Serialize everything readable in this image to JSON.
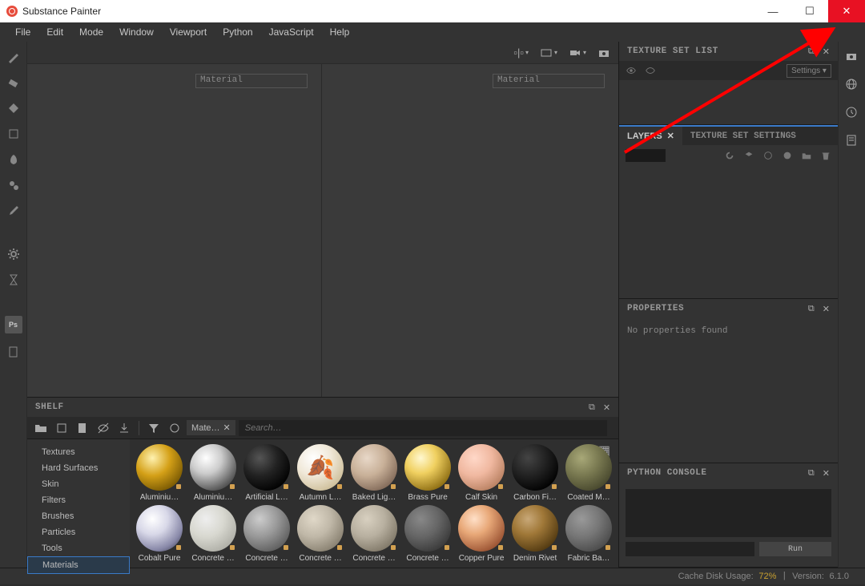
{
  "window": {
    "title": "Substance Painter"
  },
  "menu": [
    "File",
    "Edit",
    "Mode",
    "Window",
    "Viewport",
    "Python",
    "JavaScript",
    "Help"
  ],
  "viewport": {
    "material_label": "Material"
  },
  "shelf": {
    "title": "SHELF",
    "filter_tag": "Mate…",
    "search_placeholder": "Search…",
    "categories": [
      "Textures",
      "Hard Surfaces",
      "Skin",
      "Filters",
      "Brushes",
      "Particles",
      "Tools",
      "Materials"
    ],
    "active_category": "Materials",
    "materials_row1": [
      "Aluminiu…",
      "Aluminiu…",
      "Artificial L…",
      "Autumn L…",
      "Baked Lig…",
      "Brass Pure",
      "Calf Skin",
      "Carbon Fi…",
      "Coated M…"
    ],
    "materials_row2": [
      "Cobalt Pure",
      "Concrete …",
      "Concrete …",
      "Concrete …",
      "Concrete …",
      "Concrete …",
      "Copper Pure",
      "Denim Rivet",
      "Fabric Ba…"
    ]
  },
  "panels": {
    "texture_set_list": {
      "title": "TEXTURE SET LIST",
      "settings_label": "Settings"
    },
    "layers": {
      "tab_layers": "LAYERS",
      "tab_settings": "TEXTURE SET SETTINGS"
    },
    "properties": {
      "title": "PROPERTIES",
      "empty": "No properties found"
    },
    "python": {
      "title": "PYTHON CONSOLE",
      "run": "Run"
    }
  },
  "status": {
    "cache_label": "Cache Disk Usage:",
    "cache_value": "72%",
    "version_label": "Version:",
    "version_value": "6.1.0"
  }
}
